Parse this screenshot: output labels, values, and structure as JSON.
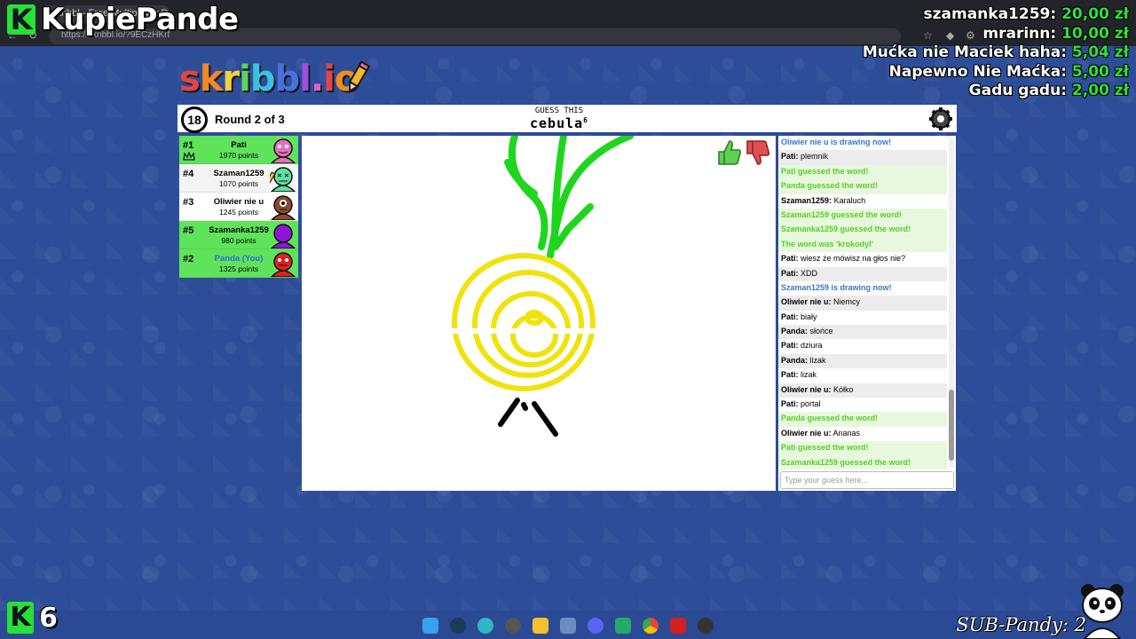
{
  "browser": {
    "tab_title": "skribbl - Free Multiplayer Drawin...",
    "url": "https://skribbl.io/?9ECzHKrf"
  },
  "overlay": {
    "channel_name": "KupiePande",
    "k_count": "6",
    "sub_counter": "SUB-Pandy: 2",
    "donations": [
      {
        "name": "szamanka1259:",
        "amount": "20,00 zł"
      },
      {
        "name": "mrarinn:",
        "amount": "10,00 zł"
      },
      {
        "name": "Mućka nie Maciek haha:",
        "amount": "5,04 zł"
      },
      {
        "name": "Napewno Nie Maćka:",
        "amount": "5,00 zł"
      },
      {
        "name": "Gadu gadu:",
        "amount": "2,00 zł"
      }
    ]
  },
  "game": {
    "logo": "skribbl.io",
    "timer": "18",
    "round": "Round 2 of 3",
    "guess_label": "GUESS THIS",
    "word": "cebula",
    "word_length": "6"
  },
  "players": [
    {
      "rank": "#1",
      "name": "Pati",
      "points": "1970 points",
      "color": "#e86fbf",
      "you": false
    },
    {
      "rank": "#4",
      "name": "Szaman1259",
      "points": "1070 points",
      "color": "#5fe0a0",
      "you": false
    },
    {
      "rank": "#3",
      "name": "Oliwier nie u",
      "points": "1245 points",
      "color": "#8a4b2a",
      "you": false
    },
    {
      "rank": "#5",
      "name": "Szamanka1259",
      "points": "980 points",
      "color": "#8f14d8",
      "you": false
    },
    {
      "rank": "#2",
      "name": "Panda (You)",
      "points": "1325 points",
      "color": "#e02020",
      "you": true
    }
  ],
  "chat": {
    "messages": [
      {
        "type": "blue",
        "user": "",
        "text": "Oliwier nie u is drawing now!"
      },
      {
        "type": "normal",
        "user": "Pati:",
        "text": "plemnik"
      },
      {
        "type": "green",
        "user": "",
        "text": "Pati guessed the word!"
      },
      {
        "type": "green",
        "user": "",
        "text": "Panda guessed the word!"
      },
      {
        "type": "normal",
        "user": "Szaman1259:",
        "text": "Karaluch"
      },
      {
        "type": "green",
        "user": "",
        "text": "Szaman1259 guessed the word!"
      },
      {
        "type": "green",
        "user": "",
        "text": "Szamanka1259 guessed the word!"
      },
      {
        "type": "green",
        "user": "",
        "text": "The word was 'krokodyl'"
      },
      {
        "type": "normal",
        "user": "Pati:",
        "text": "wiesz że mówisz na głos nie?"
      },
      {
        "type": "normal",
        "user": "Pati:",
        "text": "XDD"
      },
      {
        "type": "blue",
        "user": "",
        "text": "Szaman1259 is drawing now!"
      },
      {
        "type": "normal",
        "user": "Oliwier nie u:",
        "text": "Niemcy"
      },
      {
        "type": "normal",
        "user": "Pati:",
        "text": "biały"
      },
      {
        "type": "normal",
        "user": "Panda:",
        "text": "słońce"
      },
      {
        "type": "normal",
        "user": "Pati:",
        "text": "dziura"
      },
      {
        "type": "normal",
        "user": "Panda:",
        "text": "lizak"
      },
      {
        "type": "normal",
        "user": "Pati:",
        "text": "lizak"
      },
      {
        "type": "normal",
        "user": "Oliwier nie u:",
        "text": "Kółko"
      },
      {
        "type": "normal",
        "user": "Pati:",
        "text": "portal"
      },
      {
        "type": "green",
        "user": "",
        "text": "Panda guessed the word!"
      },
      {
        "type": "normal",
        "user": "Oliwier nie u:",
        "text": "Ananas"
      },
      {
        "type": "green",
        "user": "",
        "text": "Pati guessed the word!"
      },
      {
        "type": "green",
        "user": "",
        "text": "Szamanka1259 guessed the word!"
      }
    ],
    "input_placeholder": "Type your guess here..."
  }
}
